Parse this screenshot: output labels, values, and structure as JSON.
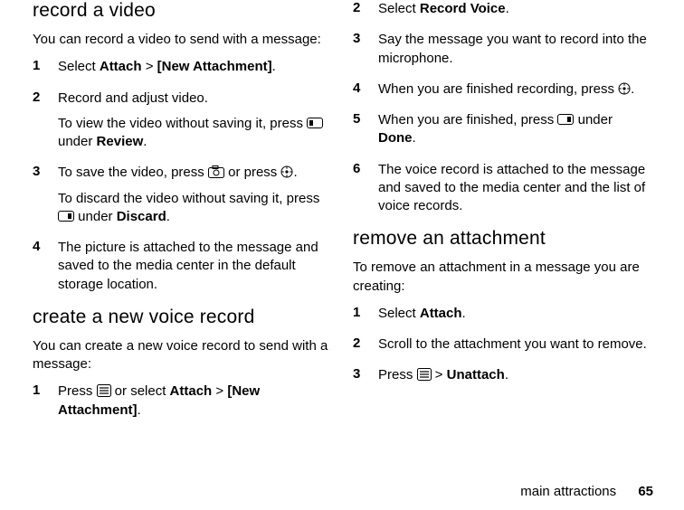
{
  "left": {
    "h1": "record a video",
    "intro": "You can record a video to send with a message:",
    "steps": [
      {
        "num": "1",
        "paras": [
          [
            "Select ",
            {
              "b": "Attach"
            },
            " > ",
            {
              "b": "[New Attachment]"
            },
            "."
          ]
        ]
      },
      {
        "num": "2",
        "paras": [
          [
            "Record and adjust video."
          ],
          [
            "To view the video without saving it, press ",
            {
              "icon": "softkey-left"
            },
            " under ",
            {
              "b": "Review"
            },
            "."
          ]
        ]
      },
      {
        "num": "3",
        "paras": [
          [
            "To save the video, press ",
            {
              "icon": "camera"
            },
            " or press ",
            {
              "icon": "nav-center"
            },
            "."
          ],
          [
            "To discard the video without saving it, press ",
            {
              "icon": "softkey-right"
            },
            " under ",
            {
              "b": "Discard"
            },
            "."
          ]
        ]
      },
      {
        "num": "4",
        "paras": [
          [
            "The picture is attached to the message and saved to the media center in the default storage location."
          ]
        ]
      }
    ],
    "h2": "create a new voice record",
    "intro2": "You can create a new voice record to send with a message:",
    "steps2": [
      {
        "num": "1",
        "paras": [
          [
            "Press ",
            {
              "icon": "menu"
            },
            " or select ",
            {
              "b": "Attach"
            },
            " > ",
            {
              "b": "[New Attachment]"
            },
            "."
          ]
        ]
      }
    ]
  },
  "right": {
    "steps": [
      {
        "num": "2",
        "paras": [
          [
            "Select ",
            {
              "b": "Record Voice"
            },
            "."
          ]
        ]
      },
      {
        "num": "3",
        "paras": [
          [
            "Say the message you want to record into the microphone."
          ]
        ]
      },
      {
        "num": "4",
        "paras": [
          [
            "When you are finished recording, press ",
            {
              "icon": "nav-center"
            },
            "."
          ]
        ]
      },
      {
        "num": "5",
        "paras": [
          [
            "When you are finished, press ",
            {
              "icon": "softkey-right"
            },
            " under ",
            {
              "b": "Done"
            },
            "."
          ]
        ]
      },
      {
        "num": "6",
        "paras": [
          [
            "The voice record is attached to the message and saved to the media center and the list of voice records."
          ]
        ]
      }
    ],
    "h2": "remove an attachment",
    "intro": "To remove an attachment in a message you are creating:",
    "steps2": [
      {
        "num": "1",
        "paras": [
          [
            "Select ",
            {
              "b": "Attach"
            },
            "."
          ]
        ]
      },
      {
        "num": "2",
        "paras": [
          [
            "Scroll to the attachment you want to remove."
          ]
        ]
      },
      {
        "num": "3",
        "paras": [
          [
            "Press ",
            {
              "icon": "menu"
            },
            " > ",
            {
              "b": "Unattach"
            },
            "."
          ]
        ]
      }
    ]
  },
  "footer": {
    "section": "main attractions",
    "page": "65"
  }
}
